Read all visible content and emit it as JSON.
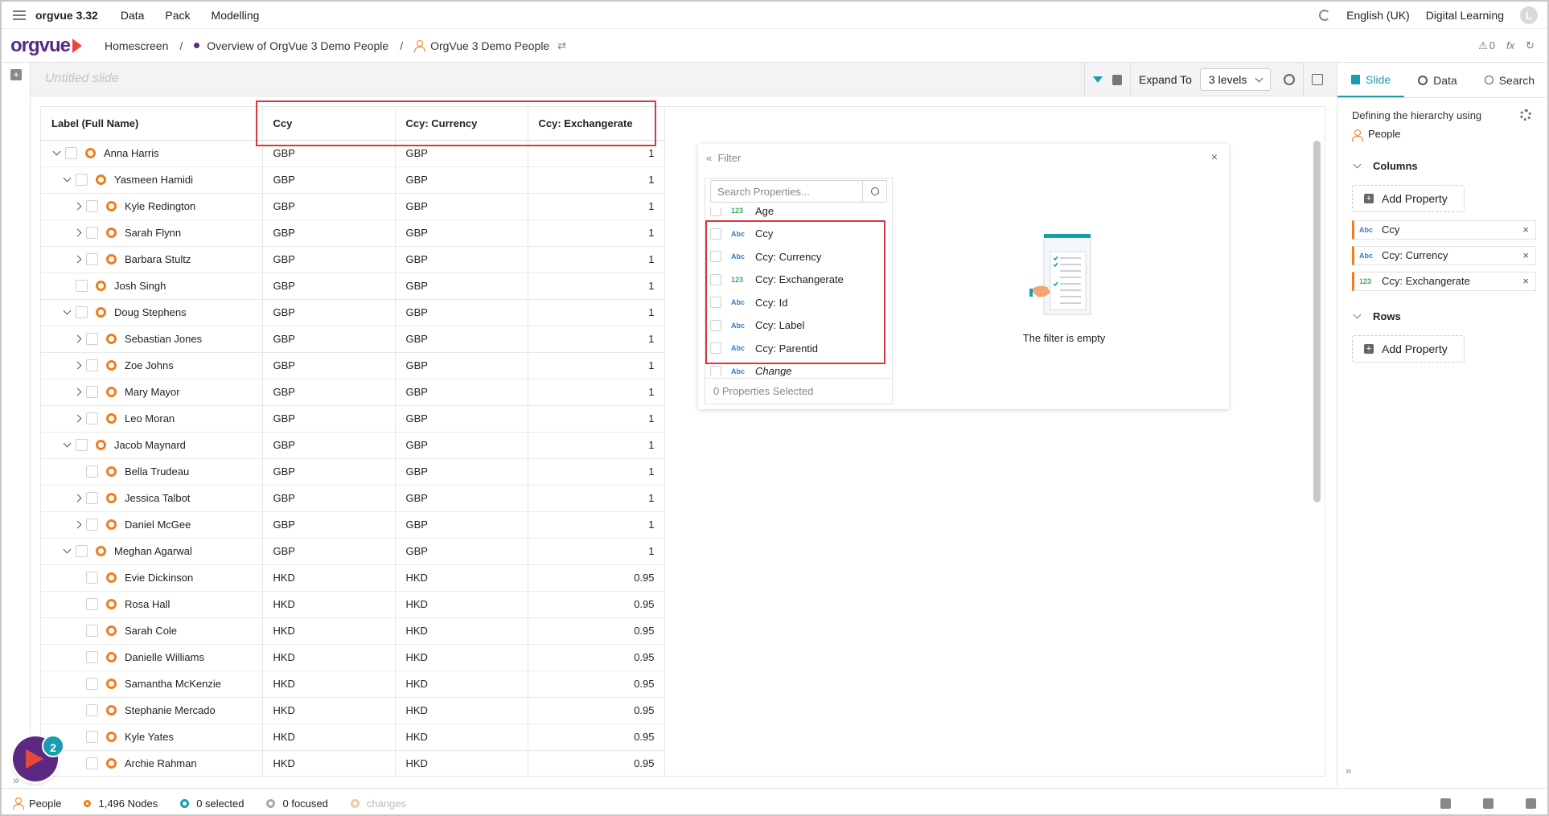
{
  "menubar": {
    "app_name": "orgvue 3.32",
    "items": [
      "Data",
      "Pack",
      "Modelling"
    ],
    "language": "English (UK)",
    "org": "Digital Learning",
    "avatar_letter": "L"
  },
  "breadcrumb": {
    "logo": "orgvue",
    "home": "Homescreen",
    "overview": "Overview of OrgVue 3 Demo People",
    "dataset": "OrgVue 3 Demo People",
    "right_count": "0",
    "fx": "fx"
  },
  "slide": {
    "title_placeholder": "Untitled slide",
    "expand_label": "Expand To",
    "expand_value": "3 levels"
  },
  "table": {
    "headers": [
      "Label (Full Name)",
      "Ccy",
      "Ccy: Currency",
      "Ccy: Exchangerate"
    ],
    "rows": [
      {
        "indent": 0,
        "toggle": "open",
        "name": "Anna Harris",
        "ccy": "GBP",
        "cur": "GBP",
        "rate": "1"
      },
      {
        "indent": 1,
        "toggle": "open",
        "name": "Yasmeen Hamidi",
        "ccy": "GBP",
        "cur": "GBP",
        "rate": "1"
      },
      {
        "indent": 2,
        "toggle": "closed",
        "name": "Kyle Redington",
        "ccy": "GBP",
        "cur": "GBP",
        "rate": "1"
      },
      {
        "indent": 2,
        "toggle": "closed",
        "name": "Sarah Flynn",
        "ccy": "GBP",
        "cur": "GBP",
        "rate": "1"
      },
      {
        "indent": 2,
        "toggle": "closed",
        "name": "Barbara Stultz",
        "ccy": "GBP",
        "cur": "GBP",
        "rate": "1"
      },
      {
        "indent": 1,
        "toggle": "none",
        "name": "Josh Singh",
        "ccy": "GBP",
        "cur": "GBP",
        "rate": "1"
      },
      {
        "indent": 1,
        "toggle": "open",
        "name": "Doug Stephens",
        "ccy": "GBP",
        "cur": "GBP",
        "rate": "1"
      },
      {
        "indent": 2,
        "toggle": "closed",
        "name": "Sebastian Jones",
        "ccy": "GBP",
        "cur": "GBP",
        "rate": "1"
      },
      {
        "indent": 2,
        "toggle": "closed",
        "name": "Zoe Johns",
        "ccy": "GBP",
        "cur": "GBP",
        "rate": "1"
      },
      {
        "indent": 2,
        "toggle": "closed",
        "name": "Mary Mayor",
        "ccy": "GBP",
        "cur": "GBP",
        "rate": "1"
      },
      {
        "indent": 2,
        "toggle": "closed",
        "name": "Leo Moran",
        "ccy": "GBP",
        "cur": "GBP",
        "rate": "1"
      },
      {
        "indent": 1,
        "toggle": "open",
        "name": "Jacob Maynard",
        "ccy": "GBP",
        "cur": "GBP",
        "rate": "1"
      },
      {
        "indent": 2,
        "toggle": "none",
        "name": "Bella Trudeau",
        "ccy": "GBP",
        "cur": "GBP",
        "rate": "1"
      },
      {
        "indent": 2,
        "toggle": "closed",
        "name": "Jessica Talbot",
        "ccy": "GBP",
        "cur": "GBP",
        "rate": "1"
      },
      {
        "indent": 2,
        "toggle": "closed",
        "name": "Daniel McGee",
        "ccy": "GBP",
        "cur": "GBP",
        "rate": "1"
      },
      {
        "indent": 1,
        "toggle": "open",
        "name": "Meghan Agarwal",
        "ccy": "GBP",
        "cur": "GBP",
        "rate": "1"
      },
      {
        "indent": 2,
        "toggle": "none",
        "name": "Evie Dickinson",
        "ccy": "HKD",
        "cur": "HKD",
        "rate": "0.95"
      },
      {
        "indent": 2,
        "toggle": "none",
        "name": "Rosa Hall",
        "ccy": "HKD",
        "cur": "HKD",
        "rate": "0.95"
      },
      {
        "indent": 2,
        "toggle": "none",
        "name": "Sarah Cole",
        "ccy": "HKD",
        "cur": "HKD",
        "rate": "0.95"
      },
      {
        "indent": 2,
        "toggle": "none",
        "name": "Danielle Williams",
        "ccy": "HKD",
        "cur": "HKD",
        "rate": "0.95"
      },
      {
        "indent": 2,
        "toggle": "none",
        "name": "Samantha McKenzie",
        "ccy": "HKD",
        "cur": "HKD",
        "rate": "0.95"
      },
      {
        "indent": 2,
        "toggle": "none",
        "name": "Stephanie Mercado",
        "ccy": "HKD",
        "cur": "HKD",
        "rate": "0.95"
      },
      {
        "indent": 2,
        "toggle": "none",
        "name": "Kyle Yates",
        "ccy": "HKD",
        "cur": "HKD",
        "rate": "0.95"
      },
      {
        "indent": 2,
        "toggle": "none",
        "name": "Archie Rahman",
        "ccy": "HKD",
        "cur": "HKD",
        "rate": "0.95"
      }
    ]
  },
  "filter": {
    "title": "Filter",
    "search_placeholder": "Search Properties...",
    "items": [
      {
        "type": "123",
        "label": "Age"
      },
      {
        "type": "Abc",
        "label": "Ccy"
      },
      {
        "type": "Abc",
        "label": "Ccy: Currency"
      },
      {
        "type": "123",
        "label": "Ccy: Exchangerate"
      },
      {
        "type": "Abc",
        "label": "Ccy: Id"
      },
      {
        "type": "Abc",
        "label": "Ccy: Label"
      },
      {
        "type": "Abc",
        "label": "Ccy: Parentid"
      },
      {
        "type": "Abc",
        "label": "Change"
      }
    ],
    "footer": "0 Properties Selected",
    "empty_text": "The filter is empty"
  },
  "rightpanel": {
    "tabs": [
      "Slide",
      "Data",
      "Search"
    ],
    "defining": "Defining the hierarchy using",
    "dimension": "People",
    "columns_label": "Columns",
    "add_property": "Add Property",
    "columns": [
      {
        "type": "Abc",
        "label": "Ccy"
      },
      {
        "type": "Abc",
        "label": "Ccy: Currency"
      },
      {
        "type": "123",
        "label": "Ccy: Exchangerate"
      }
    ],
    "rows_label": "Rows"
  },
  "status": {
    "dimension": "People",
    "nodes": "1,496 Nodes",
    "selected": "0 selected",
    "focused": "0 focused",
    "changes": "changes"
  },
  "badge_count": "2",
  "colors": {
    "accent": "#1a9bb0",
    "brand_purple": "#5a2a83",
    "node_orange": "#f07d1f",
    "highlight_red": "#d9363e"
  }
}
